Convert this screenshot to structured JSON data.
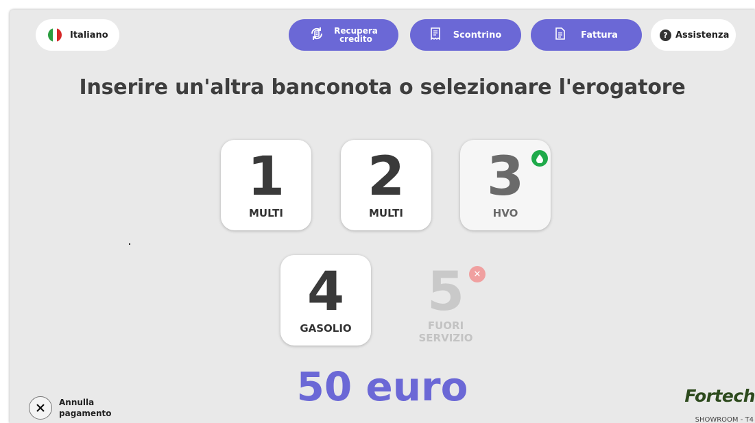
{
  "header": {
    "language": "Italiano",
    "recupera_label_line1": "Recupera",
    "recupera_label_line2": "credito",
    "scontrino_label": "Scontrino",
    "fattura_label": "Fattura",
    "assistenza_label": "Assistenza"
  },
  "title": "Inserire un'altra banconota o selezionare l'erogatore",
  "pumps": [
    {
      "number": "1",
      "label": "MULTI"
    },
    {
      "number": "2",
      "label": "MULTI"
    },
    {
      "number": "3",
      "label": "HVO"
    },
    {
      "number": "4",
      "label": "GASOLIO"
    },
    {
      "number": "5",
      "label_line1": "FUORI",
      "label_line2": "SERVIZIO"
    }
  ],
  "amount": "50 euro",
  "cancel": {
    "line1": "Annulla",
    "line2": "pagamento"
  },
  "brand": "Fortech",
  "station": "SHOWROOM - T4",
  "colors": {
    "accent": "#6b68d6",
    "available": "#1faa4a",
    "out_of_service": "#f0a0a0"
  },
  "icons": {
    "language": "italy-flag-icon",
    "recupera": "credit-refresh-icon",
    "scontrino": "receipt-icon",
    "fattura": "invoice-icon",
    "assistenza": "help-icon",
    "cancel": "close-icon"
  }
}
